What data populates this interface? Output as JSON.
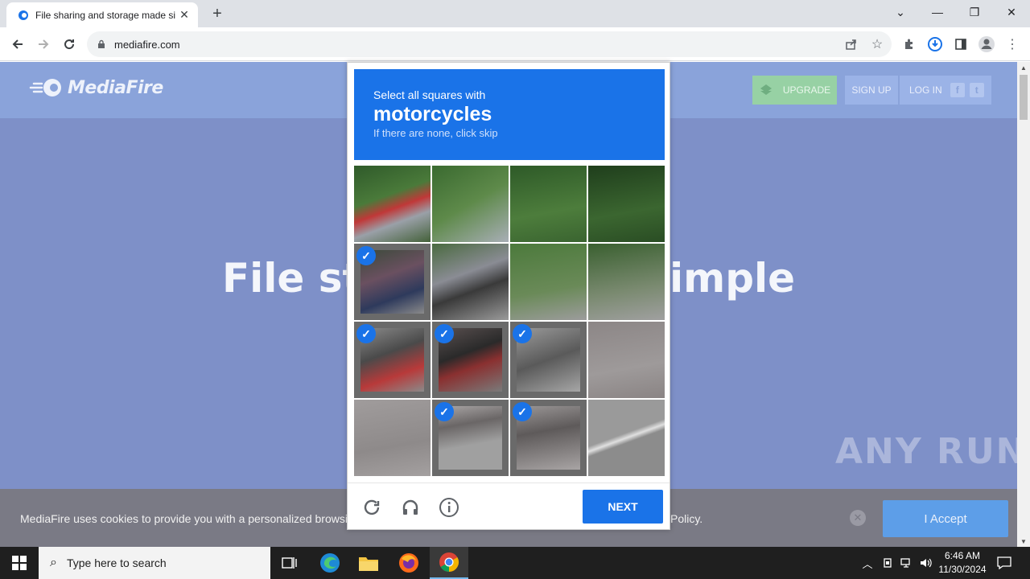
{
  "browser": {
    "tab_title": "File sharing and storage made si",
    "url": "mediafire.com",
    "icons": [
      "back-icon",
      "forward-icon",
      "reload-icon",
      "lock-icon",
      "share-icon",
      "star-icon",
      "extensions-icon",
      "download-icon",
      "sidepanel-icon",
      "profile-icon",
      "menu-icon"
    ]
  },
  "site": {
    "logo_text": "MediaFire",
    "upgrade_label": "UPGRADE",
    "signup_label": "SIGN UP",
    "login_label": "LOG IN",
    "hero_text": "File storage made simple",
    "cookie_text": "MediaFire uses cookies to provide you with a personalized browsing",
    "cookie_tail": "Policy.",
    "accept_label": "I Accept",
    "watermark": "ANY RUN"
  },
  "captcha": {
    "instruction": "Select all squares with",
    "target": "motorcycles",
    "hint": "If there are none, click skip",
    "next_label": "NEXT",
    "selected": [
      false,
      false,
      false,
      false,
      true,
      false,
      false,
      false,
      true,
      true,
      true,
      false,
      false,
      true,
      true,
      false
    ]
  },
  "taskbar": {
    "search_placeholder": "Type here to search",
    "time": "6:46 AM",
    "date": "11/30/2024"
  }
}
